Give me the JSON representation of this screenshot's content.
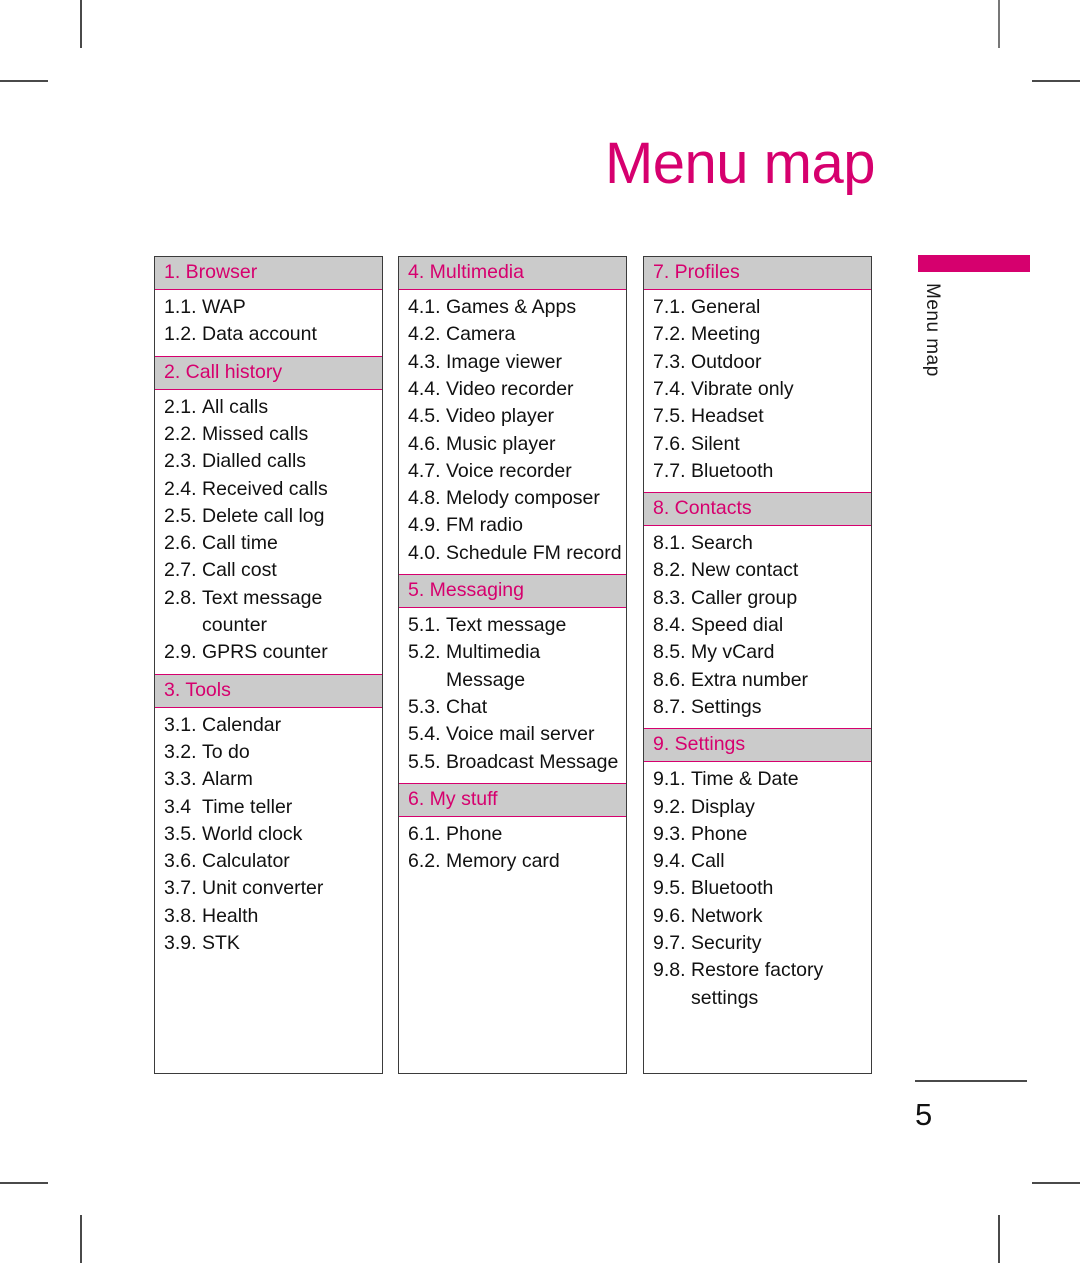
{
  "page": {
    "title": "Menu map",
    "side_tab_label": "Menu map",
    "folio": "5",
    "accent_color": "#d6006e",
    "header_bg_color": "#cbcbcb",
    "text_color": "#111111"
  },
  "columns": [
    {
      "groups": [
        {
          "header": "1. Browser",
          "items": [
            {
              "num": "1.1.",
              "label": "WAP"
            },
            {
              "num": "1.2.",
              "label": "Data account"
            }
          ]
        },
        {
          "header": "2. Call history",
          "items": [
            {
              "num": "2.1.",
              "label": "All calls"
            },
            {
              "num": "2.2.",
              "label": "Missed calls"
            },
            {
              "num": "2.3.",
              "label": "Dialled calls"
            },
            {
              "num": "2.4.",
              "label": "Received calls"
            },
            {
              "num": "2.5.",
              "label": "Delete call log"
            },
            {
              "num": "2.6.",
              "label": "Call time"
            },
            {
              "num": "2.7.",
              "label": "Call cost"
            },
            {
              "num": "2.8.",
              "label": "Text message counter"
            },
            {
              "num": "2.9.",
              "label": "GPRS counter"
            }
          ]
        },
        {
          "header": "3. Tools",
          "items": [
            {
              "num": "3.1.",
              "label": "Calendar"
            },
            {
              "num": "3.2.",
              "label": "To do"
            },
            {
              "num": "3.3.",
              "label": "Alarm"
            },
            {
              "num": "3.4",
              "label": "Time teller"
            },
            {
              "num": "3.5.",
              "label": "World clock"
            },
            {
              "num": "3.6.",
              "label": "Calculator"
            },
            {
              "num": "3.7.",
              "label": "Unit converter"
            },
            {
              "num": "3.8.",
              "label": "Health"
            },
            {
              "num": "3.9.",
              "label": "STK"
            }
          ]
        }
      ]
    },
    {
      "groups": [
        {
          "header": "4. Multimedia",
          "items": [
            {
              "num": "4.1.",
              "label": "Games & Apps"
            },
            {
              "num": "4.2.",
              "label": "Camera"
            },
            {
              "num": "4.3.",
              "label": "Image viewer"
            },
            {
              "num": "4.4.",
              "label": "Video recorder"
            },
            {
              "num": "4.5.",
              "label": "Video player"
            },
            {
              "num": "4.6.",
              "label": "Music player"
            },
            {
              "num": "4.7.",
              "label": "Voice recorder"
            },
            {
              "num": "4.8.",
              "label": "Melody composer"
            },
            {
              "num": "4.9.",
              "label": "FM radio"
            },
            {
              "num": "4.0.",
              "label": "Schedule FM record"
            }
          ]
        },
        {
          "header": "5. Messaging",
          "items": [
            {
              "num": "5.1.",
              "label": "Text message"
            },
            {
              "num": "5.2.",
              "label": "Multimedia Message"
            },
            {
              "num": "5.3.",
              "label": "Chat"
            },
            {
              "num": "5.4.",
              "label": "Voice mail server"
            },
            {
              "num": "5.5.",
              "label": "Broadcast Message"
            }
          ]
        },
        {
          "header": "6. My stuff",
          "items": [
            {
              "num": "6.1.",
              "label": "Phone"
            },
            {
              "num": "6.2.",
              "label": "Memory card"
            }
          ]
        }
      ]
    },
    {
      "groups": [
        {
          "header": "7. Profiles",
          "items": [
            {
              "num": "7.1.",
              "label": "General"
            },
            {
              "num": "7.2.",
              "label": "Meeting"
            },
            {
              "num": "7.3.",
              "label": "Outdoor"
            },
            {
              "num": "7.4.",
              "label": "Vibrate only"
            },
            {
              "num": "7.5.",
              "label": "Headset"
            },
            {
              "num": "7.6.",
              "label": "Silent"
            },
            {
              "num": "7.7.",
              "label": "Bluetooth"
            }
          ]
        },
        {
          "header": "8. Contacts",
          "items": [
            {
              "num": "8.1.",
              "label": "Search"
            },
            {
              "num": "8.2.",
              "label": "New contact"
            },
            {
              "num": "8.3.",
              "label": "Caller group"
            },
            {
              "num": "8.4.",
              "label": "Speed dial"
            },
            {
              "num": "8.5.",
              "label": "My vCard"
            },
            {
              "num": "8.6.",
              "label": "Extra number"
            },
            {
              "num": "8.7.",
              "label": "Settings"
            }
          ]
        },
        {
          "header": "9. Settings",
          "items": [
            {
              "num": "9.1.",
              "label": "Time & Date"
            },
            {
              "num": "9.2.",
              "label": "Display"
            },
            {
              "num": "9.3.",
              "label": "Phone"
            },
            {
              "num": "9.4.",
              "label": "Call"
            },
            {
              "num": "9.5.",
              "label": "Bluetooth"
            },
            {
              "num": "9.6.",
              "label": "Network"
            },
            {
              "num": "9.7.",
              "label": "Security"
            },
            {
              "num": "9.8.",
              "label": "Restore factory settings"
            }
          ]
        }
      ]
    }
  ]
}
